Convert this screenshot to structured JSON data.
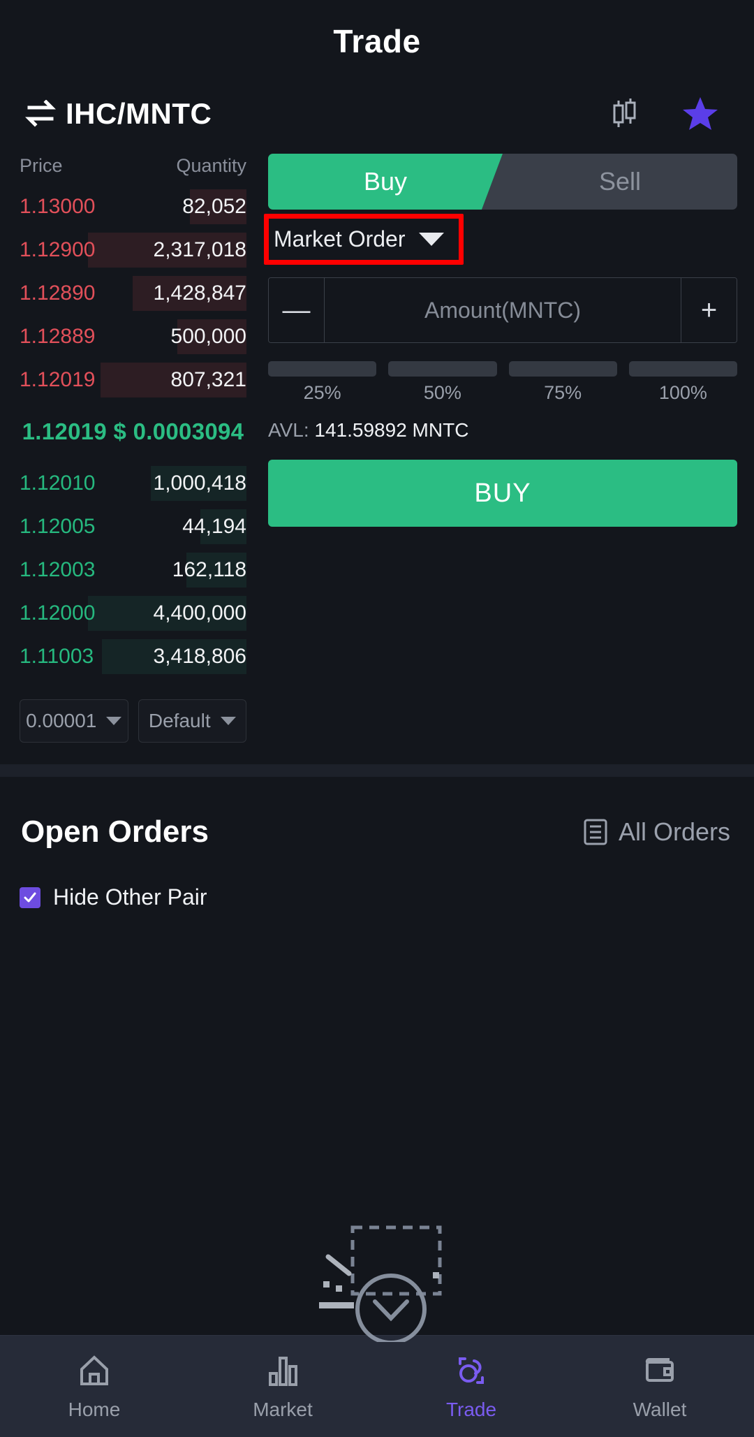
{
  "header": {
    "title": "Trade"
  },
  "pair": {
    "name": "IHC/MNTC",
    "swap_icon": "swap-icon",
    "chart_icon": "candlestick-chart-icon",
    "favorite_icon": "star-icon"
  },
  "orderbook": {
    "col_price": "Price",
    "col_quantity": "Quantity",
    "asks": [
      {
        "price": "1.13000",
        "qty": "82,052",
        "depth": 6
      },
      {
        "price": "1.12900",
        "qty": "2,317,018",
        "depth": 22
      },
      {
        "price": "1.12890",
        "qty": "1,428,847",
        "depth": 15
      },
      {
        "price": "1.12889",
        "qty": "500,000",
        "depth": 8
      },
      {
        "price": "1.12019",
        "qty": "807,321",
        "depth": 20
      }
    ],
    "mid": "1.12019 $ 0.0003094",
    "bids": [
      {
        "price": "1.12010",
        "qty": "1,000,418",
        "depth": 11
      },
      {
        "price": "1.12005",
        "qty": "44,194",
        "depth": 4
      },
      {
        "price": "1.12003",
        "qty": "162,118",
        "depth": 6
      },
      {
        "price": "1.12000",
        "qty": "4,400,000",
        "depth": 20
      },
      {
        "price": "1.11003",
        "qty": "3,418,806",
        "depth": 18
      }
    ],
    "tick_size": "0.00001",
    "depth_mode": "Default"
  },
  "orderform": {
    "buy_tab": "Buy",
    "sell_tab": "Sell",
    "order_type": "Market Order",
    "order_type_highlighted": true,
    "highlight_color": "#ff0000",
    "minus_label": "—",
    "plus_label": "+",
    "amount_value": "",
    "amount_placeholder": "Amount(MNTC)",
    "percents": [
      "25%",
      "50%",
      "75%",
      "100%"
    ],
    "avl_label": "AVL:",
    "avl_value": "141.59892 MNTC",
    "submit_label": "BUY",
    "buy_color": "#2bbd83",
    "sell_color": "#3a3f49"
  },
  "orders": {
    "title": "Open Orders",
    "all_orders": "All Orders",
    "all_orders_icon": "list-icon",
    "hide_other_pair": "Hide Other Pair",
    "hide_other_pair_checked": true,
    "checkbox_color": "#6d4ce0"
  },
  "bottomnav": {
    "items": [
      {
        "label": "Home",
        "icon": "home-icon",
        "active": false
      },
      {
        "label": "Market",
        "icon": "market-icon",
        "active": false
      },
      {
        "label": "Trade",
        "icon": "trade-icon",
        "active": true
      },
      {
        "label": "Wallet",
        "icon": "wallet-icon",
        "active": false
      }
    ],
    "active_color": "#7a5cf0"
  }
}
